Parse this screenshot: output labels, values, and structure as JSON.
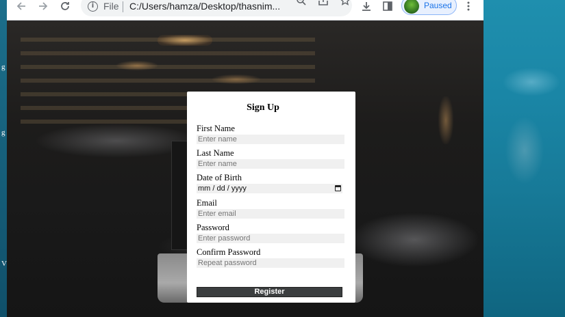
{
  "desktop": {
    "left_letters": [
      "g",
      "g",
      "V"
    ]
  },
  "browser": {
    "omnibox": {
      "scheme_label": "File",
      "url": "C:/Users/hamza/Desktop/thasnim..."
    },
    "profile": {
      "status": "Paused"
    },
    "icons": [
      "back-arrow-icon",
      "forward-arrow-icon",
      "reload-icon",
      "info-icon",
      "zoom-out-icon",
      "share-icon",
      "star-icon",
      "download-icon",
      "side-panel-icon",
      "more-menu-icon"
    ]
  },
  "form": {
    "title": "Sign Up",
    "fields": [
      {
        "label": "First Name",
        "placeholder": "Enter name"
      },
      {
        "label": "Last Name",
        "placeholder": "Enter name"
      },
      {
        "label": "Date of Birth",
        "placeholder": "mm / dd / yyyy"
      },
      {
        "label": "Email",
        "placeholder": "Enter email"
      },
      {
        "label": "Password",
        "placeholder": "Enter password"
      },
      {
        "label": "Confirm Password",
        "placeholder": "Repeat password"
      }
    ],
    "submit_label": "Register"
  },
  "colors": {
    "button_bg": "#3b3e3f",
    "input_bg": "#f0f0f0",
    "profile_accent": "#1a73e8"
  }
}
